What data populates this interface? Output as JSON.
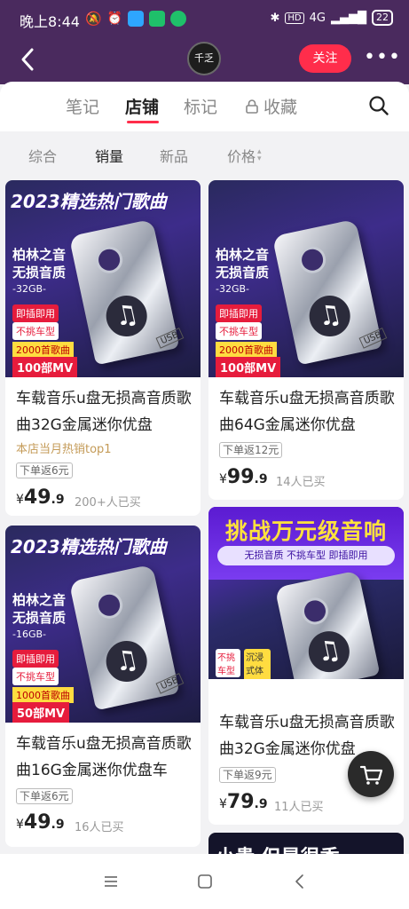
{
  "status_bar": {
    "time": "晚上8:44",
    "network": "4G",
    "battery": "22"
  },
  "header": {
    "avatar_text": "千乏",
    "follow_label": "关注",
    "more_label": "•••"
  },
  "tabs": [
    {
      "label": "笔记"
    },
    {
      "label": "店铺"
    },
    {
      "label": "标记"
    },
    {
      "label": "收藏"
    }
  ],
  "sort": [
    {
      "label": "综合"
    },
    {
      "label": "销量"
    },
    {
      "label": "新品"
    },
    {
      "label": "价格"
    }
  ],
  "products": [
    {
      "banner": "2023精选热门歌曲",
      "img_line1": "柏林之音",
      "img_line2": "无损音质",
      "img_capacity": "-32GB-",
      "img_tag1": "即插即用",
      "img_tag2": "不挑车型",
      "img_songs": "2000首歌曲",
      "img_mv": "100部MV",
      "title": "车载音乐u盘无损高音质歌曲32G金属迷你优盘",
      "promo": "本店当月热销top1",
      "coupon": "下单返6元",
      "currency": "¥",
      "price_int": "49",
      "price_dec": ".9",
      "sold": "200+人已买"
    },
    {
      "banner": "2023精选热门歌曲",
      "img_line1": "柏林之音",
      "img_line2": "无损音质",
      "img_capacity": "-32GB-",
      "img_tag1": "即插即用",
      "img_tag2": "不挑车型",
      "img_songs": "2000首歌曲",
      "img_mv": "100部MV",
      "title": "车载音乐u盘无损高音质歌曲64G金属迷你优盘",
      "coupon": "下单返12元",
      "currency": "¥",
      "price_int": "99",
      "price_dec": ".9",
      "sold": "14人已买"
    },
    {
      "banner": "2023精选热门歌曲",
      "img_line1": "柏林之音",
      "img_line2": "无损音质",
      "img_capacity": "-16GB-",
      "img_tag1": "即插即用",
      "img_tag2": "不挑车型",
      "img_songs": "1000首歌曲",
      "img_mv": "50部MV",
      "title": "车载音乐u盘无损高音质歌曲16G金属迷你优盘车",
      "coupon": "下单返6元",
      "currency": "¥",
      "price_int": "49",
      "price_dec": ".9",
      "sold": "16人已买"
    },
    {
      "banner": "挑战万元级音响",
      "img_sub": "无损音质  不挑车型  即插即用",
      "img_tag1": "不挑车型",
      "img_tag2": "沉浸式体验",
      "title": "车载音乐u盘无损高音质歌曲32G金属迷你优盘",
      "coupon": "下单返9元",
      "currency": "¥",
      "price_int": "79",
      "price_dec": ".9",
      "sold": "11人已买"
    },
    {
      "banner": "小贵 但是很香"
    }
  ],
  "colors": {
    "header_bg": "#4a2a5e",
    "accent": "#ff2d4b",
    "promo": "#c49b58",
    "page_bg": "#f2f2f4"
  }
}
